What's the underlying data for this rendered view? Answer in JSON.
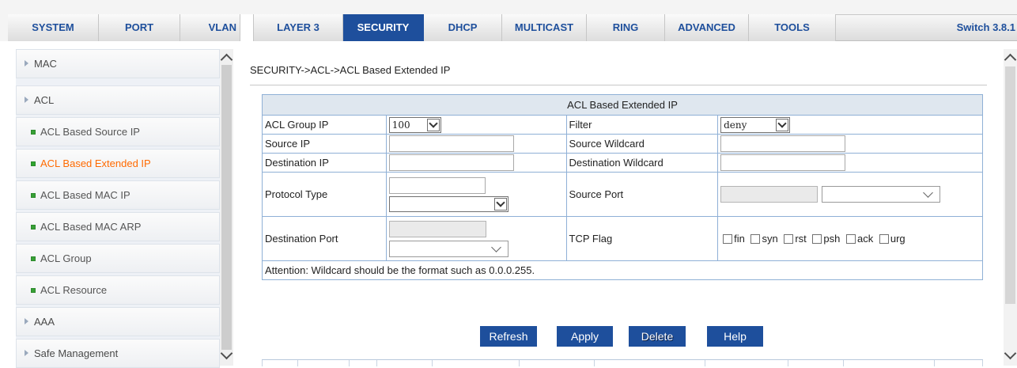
{
  "tabs": [
    {
      "label": "SYSTEM",
      "active": false
    },
    {
      "label": "PORT",
      "active": false
    },
    {
      "label": "VLAN",
      "active": false
    },
    {
      "label": "LAYER 3",
      "active": false
    },
    {
      "label": "SECURITY",
      "active": true
    },
    {
      "label": "DHCP",
      "active": false
    },
    {
      "label": "MULTICAST",
      "active": false
    },
    {
      "label": "RING",
      "active": false
    },
    {
      "label": "ADVANCED",
      "active": false
    },
    {
      "label": "TOOLS",
      "active": false
    }
  ],
  "version": "Switch 3.8.1",
  "sidebar": {
    "items": [
      {
        "label": "MAC",
        "type": "group"
      },
      {
        "label": "ACL",
        "type": "group"
      },
      {
        "label": "ACL Based Source IP",
        "type": "sub"
      },
      {
        "label": "ACL Based Extended IP",
        "type": "sub",
        "current": true
      },
      {
        "label": "ACL Based MAC IP",
        "type": "sub"
      },
      {
        "label": "ACL Based MAC ARP",
        "type": "sub"
      },
      {
        "label": "ACL Group",
        "type": "sub"
      },
      {
        "label": "ACL Resource",
        "type": "sub"
      },
      {
        "label": "AAA",
        "type": "group"
      },
      {
        "label": "Safe Management",
        "type": "group"
      }
    ]
  },
  "main": {
    "breadcrumb": "SECURITY->ACL->ACL Based Extended IP",
    "table_title": "ACL Based Extended IP",
    "fields": {
      "acl_group_ip": {
        "label": "ACL Group IP",
        "value": "100"
      },
      "filter": {
        "label": "Filter",
        "value": "deny"
      },
      "source_ip": {
        "label": "Source IP",
        "value": ""
      },
      "source_wildcard": {
        "label": "Source Wildcard",
        "value": ""
      },
      "destination_ip": {
        "label": "Destination IP",
        "value": ""
      },
      "destination_wildcard": {
        "label": "Destination Wildcard",
        "value": ""
      },
      "protocol_type": {
        "label": "Protocol Type",
        "value": ""
      },
      "source_port": {
        "label": "Source Port",
        "value": ""
      },
      "destination_port": {
        "label": "Destination Port",
        "value": ""
      },
      "tcp_flag": {
        "label": "TCP Flag",
        "flags": [
          "fin",
          "syn",
          "rst",
          "psh",
          "ack",
          "urg"
        ]
      }
    },
    "attention": "Attention: Wildcard should be the format such as 0.0.0.255.",
    "buttons": {
      "refresh": "Refresh",
      "apply": "Apply",
      "delete": "Delete",
      "help": "Help"
    }
  },
  "colors": {
    "accent": "#1e4f9c",
    "current_item": "#ff6a00",
    "bullet": "#38a036",
    "table_border": "#8fb0d6"
  }
}
